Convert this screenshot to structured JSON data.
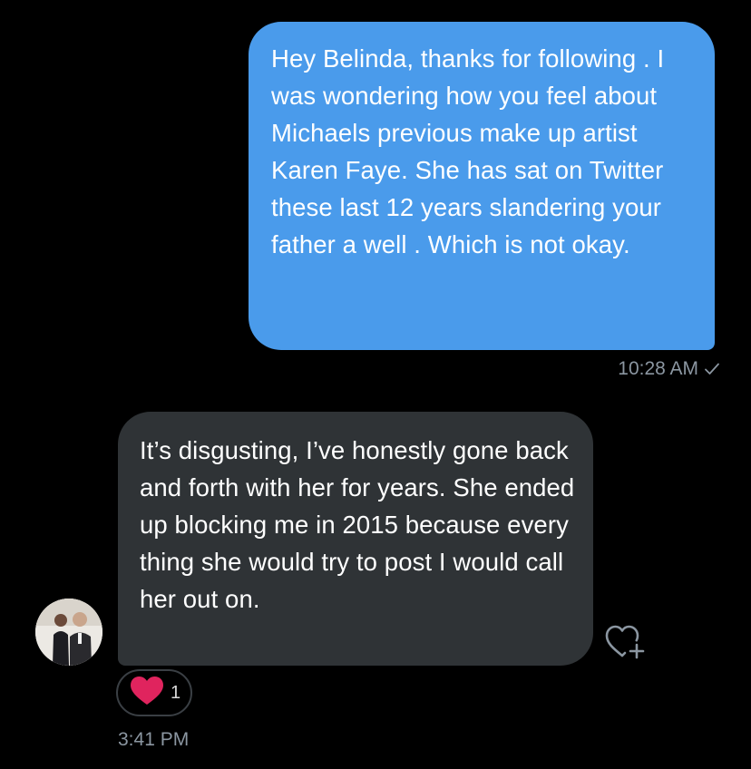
{
  "messages": {
    "outgoing": {
      "text": "Hey Belinda, thanks for following . I was wondering how you feel about Michaels previous make up artist Karen Faye. She has sat on Twitter these last 12 years slandering your father a well . Which is not okay.",
      "time": "10:28 AM",
      "status_icon": "check-icon"
    },
    "incoming": {
      "text": "It’s disgusting, I’ve honestly gone back and forth with her for years. She ended up blocking me in 2015 because every thing she would try to post I would call her out on.",
      "time": "3:41 PM",
      "reaction": {
        "emoji_icon": "heart-icon",
        "count": "1"
      },
      "add_reaction_icon": "heart-plus-icon"
    }
  },
  "colors": {
    "background": "#000000",
    "outgoing_bubble": "#4a9beb",
    "incoming_bubble": "#2f3336",
    "timestamp": "#8b96a1",
    "heart": "#e0245e"
  }
}
